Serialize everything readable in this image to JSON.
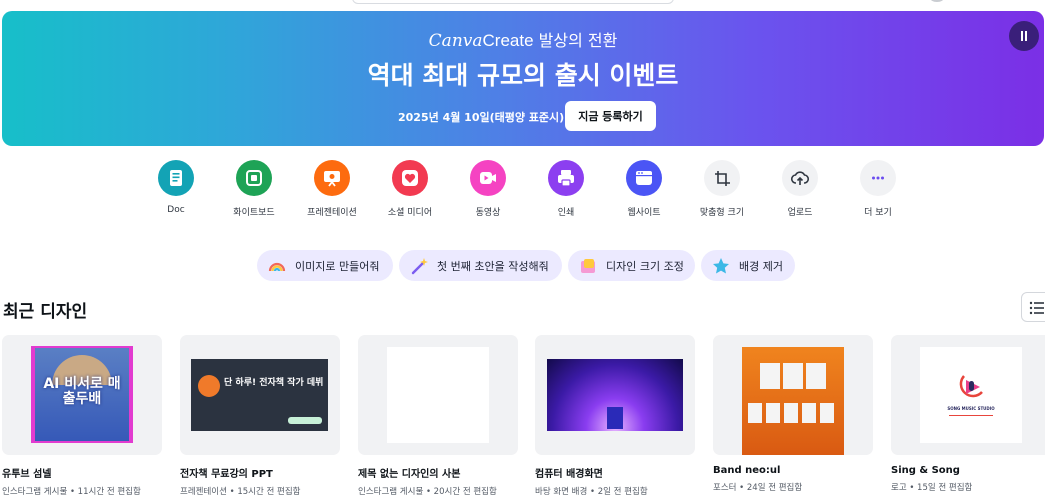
{
  "banner": {
    "logo_canva": "Canva",
    "logo_create": "Create",
    "logo_suffix": "발상의 전환",
    "headline": "역대 최대 규모의 출시 이벤트",
    "date": "2025년 4월 10일(태평양 표준시)",
    "register_label": "지금 등록하기"
  },
  "shortcuts": [
    {
      "label": "Doc",
      "color": "#13a3b5",
      "icon": "doc-icon"
    },
    {
      "label": "화이트보드",
      "color": "#1ea356",
      "icon": "whiteboard-icon"
    },
    {
      "label": "프레젠테이션",
      "color": "#fd6b0f",
      "icon": "presentation-icon"
    },
    {
      "label": "소셜 미디어",
      "color": "#f23a51",
      "icon": "heart-icon"
    },
    {
      "label": "동영상",
      "color": "#f543c2",
      "icon": "video-icon"
    },
    {
      "label": "인쇄",
      "color": "#8c3ff0",
      "icon": "print-icon"
    },
    {
      "label": "웹사이트",
      "color": "#4b55f5",
      "icon": "website-icon"
    },
    {
      "label": "맞춤형 크기",
      "color": "#f1f2f4",
      "icon": "custom-size-icon"
    },
    {
      "label": "업로드",
      "color": "#f1f2f4",
      "icon": "upload-icon"
    },
    {
      "label": "더 보기",
      "color": "#f1f2f4",
      "icon": "more-icon"
    }
  ],
  "quick_actions": [
    {
      "label": "이미지로 만들어줘",
      "icon": "rainbow-icon"
    },
    {
      "label": "첫 번째 초안을 작성해줘",
      "icon": "magic-wand-icon"
    },
    {
      "label": "디자인 크기 조정",
      "icon": "resize-icon"
    },
    {
      "label": "배경 제거",
      "icon": "star-icon"
    }
  ],
  "recent": {
    "title": "최근 디자인",
    "items": [
      {
        "name": "유투브 섬넬",
        "meta": "인스타그램 게시물 • 11시간 전 편집함",
        "thumb_text": "AI 비서로 매출두배"
      },
      {
        "name": "전자책 무료강의 PPT",
        "meta": "프레젠테이션 • 15시간 전 편집함",
        "thumb_text": "단 하루! 전자책 작가 데뷔"
      },
      {
        "name": "제목 없는 디자인의 사본",
        "meta": "인스타그램 게시물 • 20시간 전 편집함",
        "thumb_text": ""
      },
      {
        "name": "컴퓨터 배경화면",
        "meta": "바탕 화면 배경 • 2일 전 편집함",
        "thumb_text": ""
      },
      {
        "name": "Band neo:ul",
        "meta": "포스터 • 24일 전 편집함",
        "thumb_text": ""
      },
      {
        "name": "Sing & Song",
        "meta": "로고 • 15일 전 편집함",
        "thumb_text": "SONG MUSIC STUDIO"
      }
    ]
  }
}
